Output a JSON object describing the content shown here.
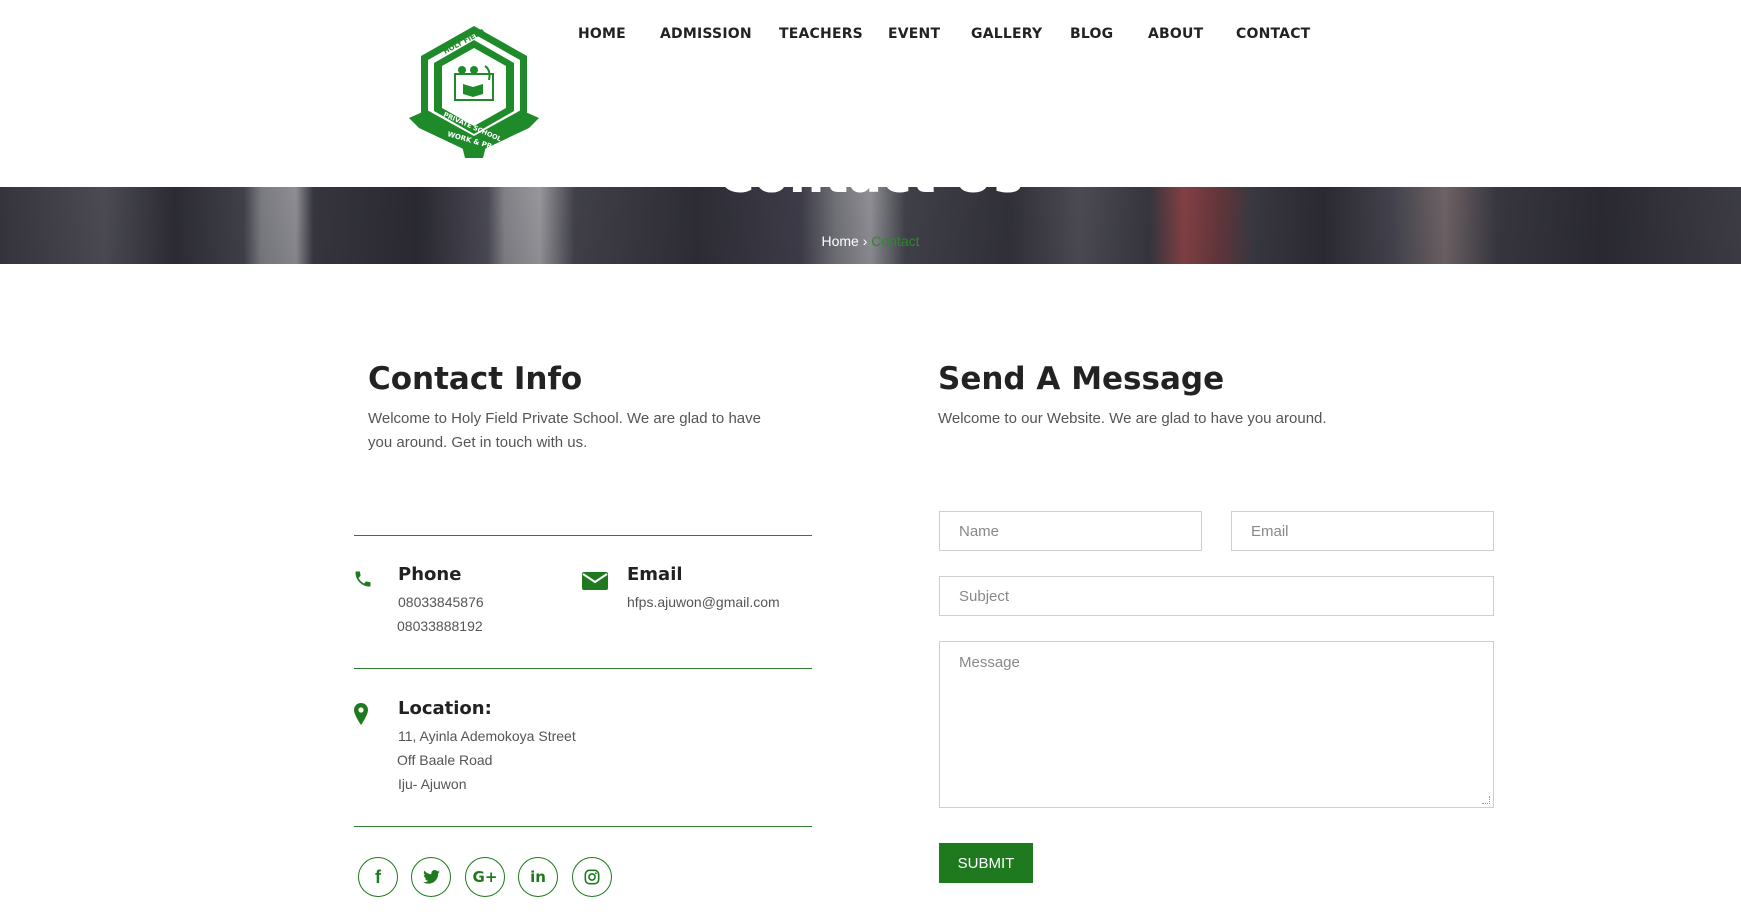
{
  "nav": {
    "items": [
      "HOME",
      "ADMISSION",
      "TEACHERS",
      "EVENT",
      "GALLERY",
      "BLOG",
      "ABOUT",
      "CONTACT"
    ]
  },
  "logo": {
    "arc_top": "HOLY FIELD",
    "arc_mid": "PRIVATE SCHOOL",
    "motto": "WORK & PRAY"
  },
  "hero": {
    "title": "Contact Us",
    "breadcrumb_home": "Home",
    "breadcrumb_sep": "›",
    "breadcrumb_current": "Contact"
  },
  "contact_info": {
    "heading": "Contact Info",
    "lead": "Welcome to Holy Field Private School. We are glad to have you around. Get in touch with us.",
    "phone_title": "Phone",
    "phone_1": "08033845876",
    "phone_2": "08033888192",
    "email_title": "Email",
    "email_value": "hfps.ajuwon@gmail.com",
    "location_title": "Location:",
    "location_1": "11, Ayinla Ademokoya Street",
    "location_2": "Off Baale Road",
    "location_3": "Iju- Ajuwon"
  },
  "social": {
    "facebook": "f",
    "google_plus": "G+",
    "linkedin": "in"
  },
  "message": {
    "heading": "Send A Message",
    "lead": "Welcome to our Website. We are glad to have you around.",
    "name_placeholder": "Name",
    "email_placeholder": "Email",
    "subject_placeholder": "Subject",
    "message_placeholder": "Message",
    "submit_label": "SUBMIT"
  },
  "colors": {
    "accent": "#1f7a1f",
    "breadcrumb_current": "#2a8a2a",
    "heading": "#222222",
    "body_text": "#555555"
  },
  "icons": [
    "phone-icon",
    "envelope-icon",
    "map-pin-icon",
    "facebook-icon",
    "twitter-icon",
    "google-plus-icon",
    "linkedin-icon",
    "instagram-icon"
  ]
}
